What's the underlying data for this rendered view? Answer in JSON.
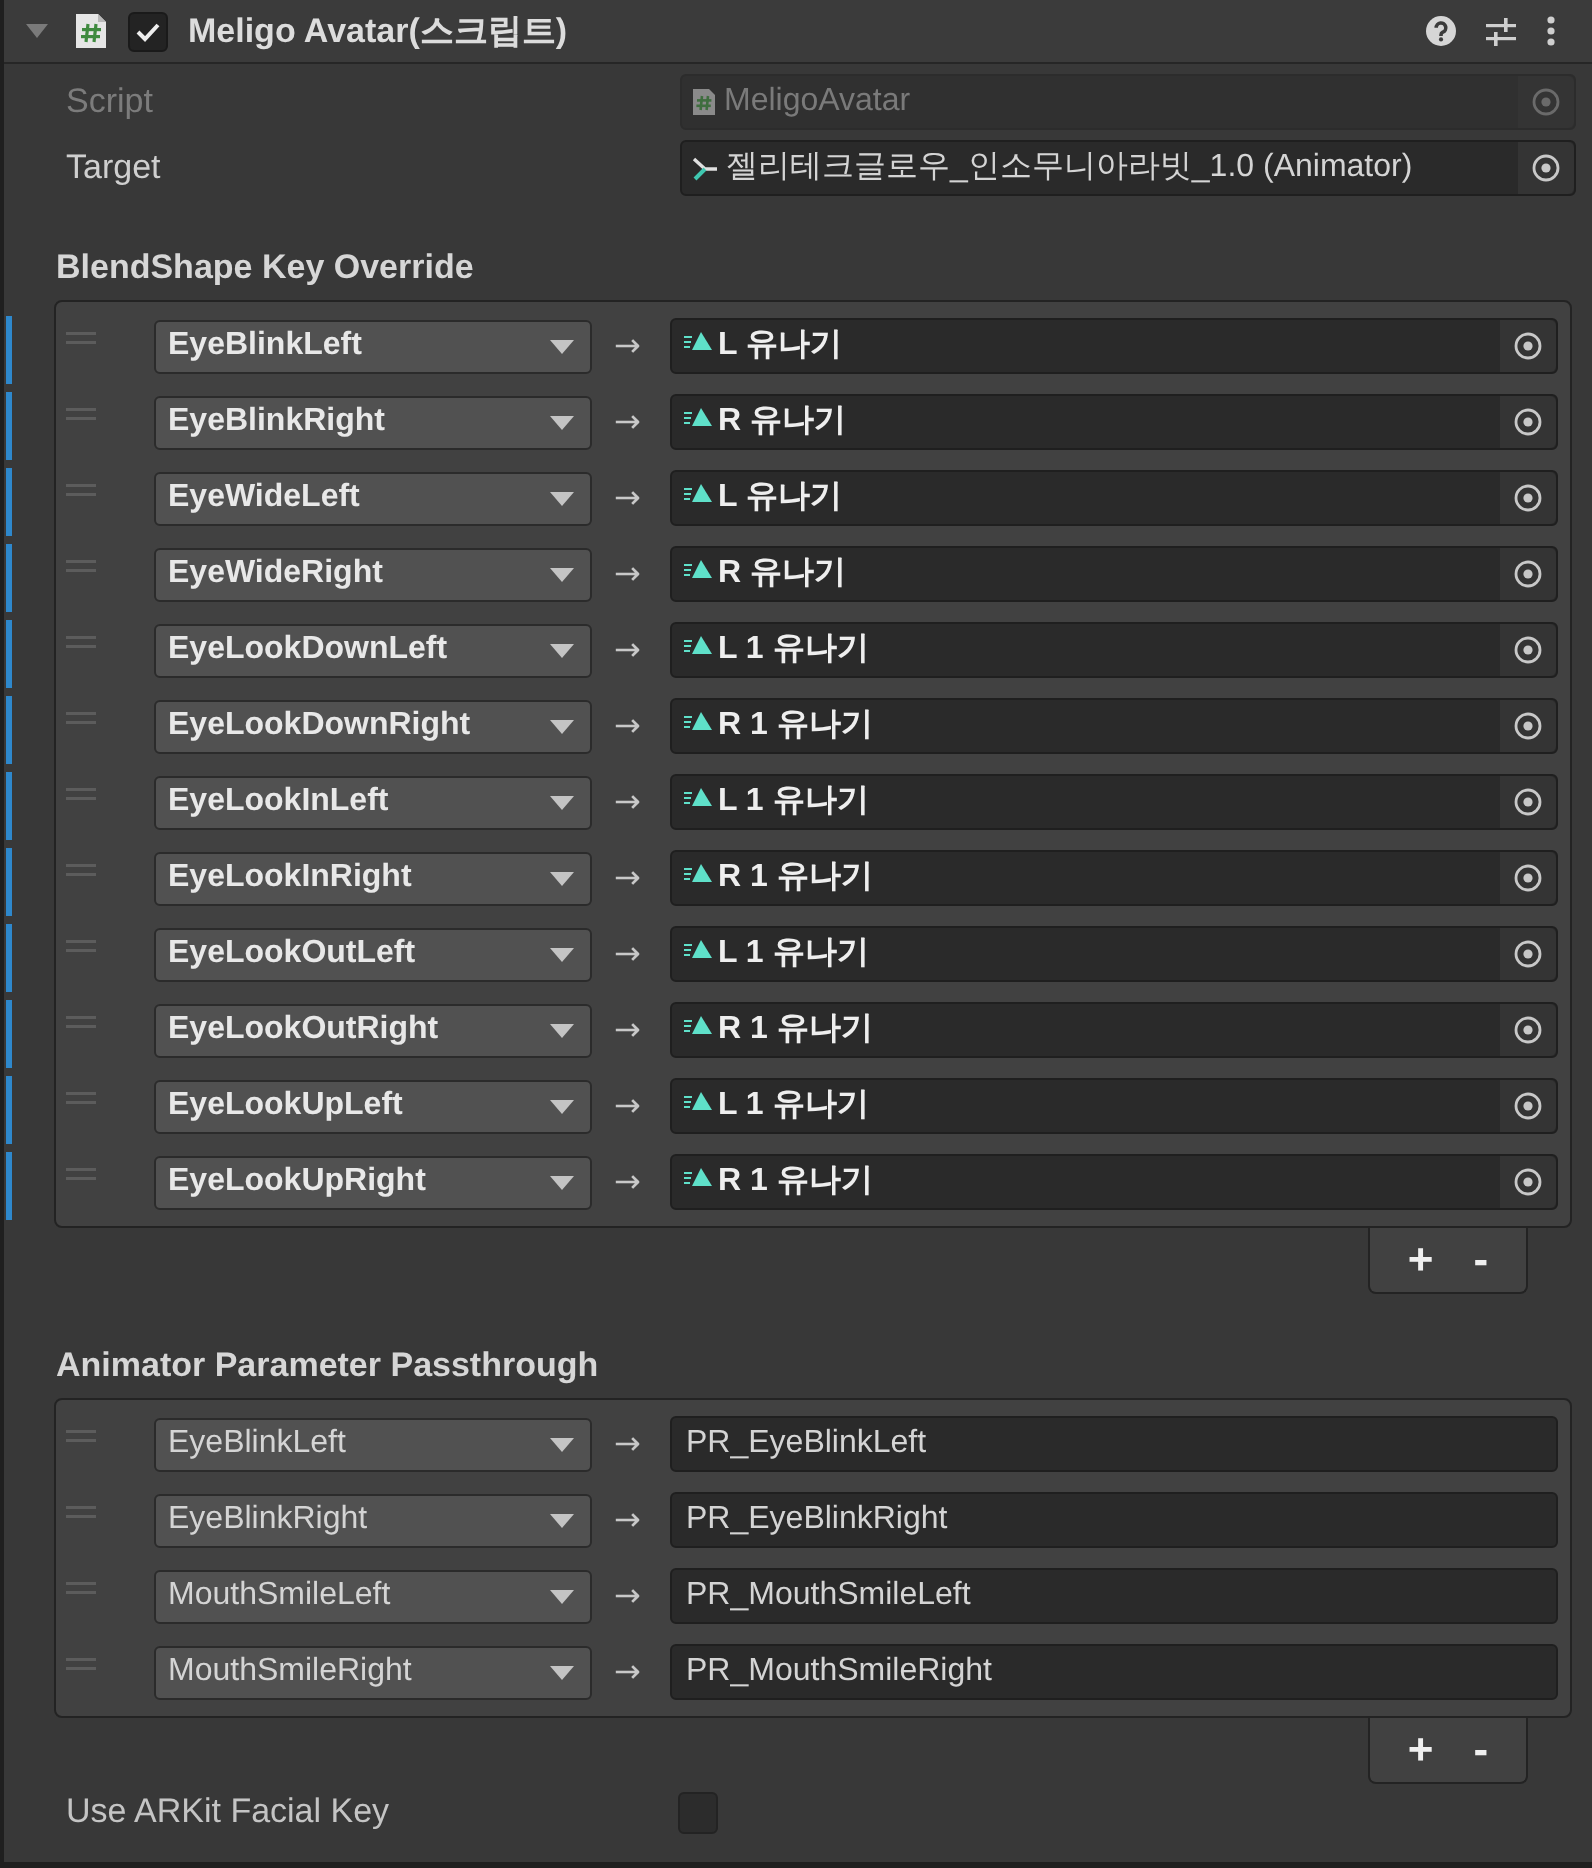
{
  "component": {
    "title": "Meligo Avatar(스크립트)",
    "expanded": true,
    "enabled": true
  },
  "properties": [
    {
      "kind": "script",
      "label": "Script",
      "value": "MeligoAvatar",
      "disabled": true
    },
    {
      "kind": "animator",
      "label": "Target",
      "value": "젤리테크글로우_인소무니아라빗_1.0 (Animator)",
      "disabled": false
    }
  ],
  "lists": [
    {
      "title": "BlendShape Key Override",
      "rows": [
        {
          "key": "EyeBlinkLeft",
          "arrow": "→",
          "kind": "object",
          "value": "L 유나기",
          "overridden": true
        },
        {
          "key": "EyeBlinkRight",
          "arrow": "→",
          "kind": "object",
          "value": "R 유나기",
          "overridden": true
        },
        {
          "key": "EyeWideLeft",
          "arrow": "→",
          "kind": "object",
          "value": "L 유나기",
          "overridden": true
        },
        {
          "key": "EyeWideRight",
          "arrow": "→",
          "kind": "object",
          "value": "R 유나기",
          "overridden": true
        },
        {
          "key": "EyeLookDownLeft",
          "arrow": "→",
          "kind": "object",
          "value": "L 1 유나기",
          "overridden": true
        },
        {
          "key": "EyeLookDownRight",
          "arrow": "→",
          "kind": "object",
          "value": "R 1 유나기",
          "overridden": true
        },
        {
          "key": "EyeLookInLeft",
          "arrow": "→",
          "kind": "object",
          "value": "L 1 유나기",
          "overridden": true
        },
        {
          "key": "EyeLookInRight",
          "arrow": "→",
          "kind": "object",
          "value": "R 1 유나기",
          "overridden": true
        },
        {
          "key": "EyeLookOutLeft",
          "arrow": "→",
          "kind": "object",
          "value": "L 1 유나기",
          "overridden": true
        },
        {
          "key": "EyeLookOutRight",
          "arrow": "→",
          "kind": "object",
          "value": "R 1 유나기",
          "overridden": true
        },
        {
          "key": "EyeLookUpLeft",
          "arrow": "→",
          "kind": "object",
          "value": "L 1 유나기",
          "overridden": true
        },
        {
          "key": "EyeLookUpRight",
          "arrow": "→",
          "kind": "object",
          "value": "R 1 유나기",
          "overridden": true
        }
      ],
      "footer": {
        "add": "+",
        "remove": "-"
      }
    },
    {
      "title": "Animator Parameter Passthrough",
      "rows": [
        {
          "key": "EyeBlinkLeft",
          "arrow": "→",
          "kind": "text",
          "value": "PR_EyeBlinkLeft",
          "overridden": false
        },
        {
          "key": "EyeBlinkRight",
          "arrow": "→",
          "kind": "text",
          "value": "PR_EyeBlinkRight",
          "overridden": false
        },
        {
          "key": "MouthSmileLeft",
          "arrow": "→",
          "kind": "text",
          "value": "PR_MouthSmileLeft",
          "overridden": false
        },
        {
          "key": "MouthSmileRight",
          "arrow": "→",
          "kind": "text",
          "value": "PR_MouthSmileRight",
          "overridden": false
        }
      ],
      "footer": {
        "add": "+",
        "remove": "-"
      }
    }
  ],
  "use_arkit_facial_key": {
    "label": "Use ARKit Facial Key",
    "checked": false
  }
}
